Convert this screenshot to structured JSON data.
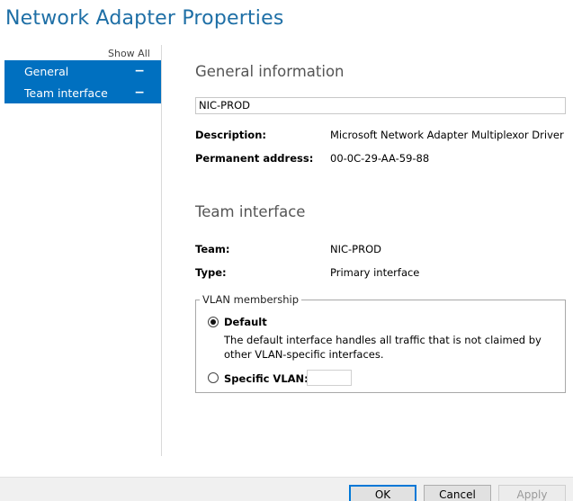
{
  "window": {
    "title": "Network Adapter Properties"
  },
  "nav": {
    "show_all": "Show All",
    "items": [
      {
        "label": "General",
        "collapse": "−"
      },
      {
        "label": "Team interface",
        "collapse": "−"
      }
    ]
  },
  "general": {
    "heading": "General information",
    "name_value": "NIC-PROD",
    "description_label": "Description:",
    "description_value": "Microsoft Network Adapter Multiplexor Driver",
    "address_label": "Permanent address:",
    "address_value": "00-0C-29-AA-59-88"
  },
  "team": {
    "heading": "Team interface",
    "team_label": "Team:",
    "team_value": "NIC-PROD",
    "type_label": "Type:",
    "type_value": "Primary interface",
    "vlan": {
      "legend": "VLAN membership",
      "default_label": "Default",
      "default_desc": "The default interface handles all traffic that is not claimed by other VLAN-specific interfaces.",
      "specific_label": "Specific VLAN:",
      "specific_value": "",
      "selected": "Default"
    }
  },
  "buttons": {
    "ok": "OK",
    "cancel": "Cancel",
    "apply": "Apply"
  }
}
